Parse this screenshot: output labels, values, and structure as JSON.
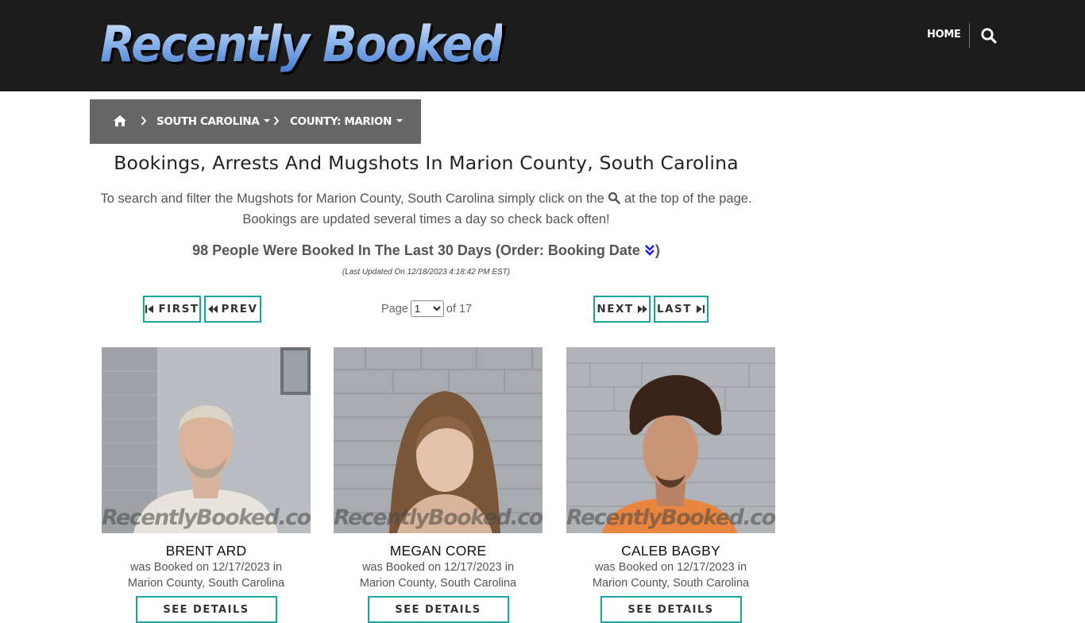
{
  "header": {
    "logo_text": "Recently Booked",
    "nav_home": "HOME",
    "search_icon": "search-icon"
  },
  "breadcrumb": {
    "home_icon": "home-icon",
    "items": [
      {
        "label": "SOUTH CAROLINA"
      },
      {
        "label": "COUNTY: MARION"
      }
    ]
  },
  "main": {
    "title": "Bookings, Arrests And Mugshots In Marion County, South Carolina",
    "intro_part1": "To search and filter the Mugshots for Marion County, South Carolina simply click on the",
    "intro_part2": "at the top of the page.",
    "intro_line2": "Bookings are updated several times a day so check back often!",
    "count_text": "98 People Were Booked In The Last 30 Days (Order: Booking Date",
    "count_close": ")",
    "updated": "(Last Updated On 12/18/2023 4:18:42 PM EST)"
  },
  "pagination": {
    "first": "FIRST",
    "prev": "PREV",
    "next": "NEXT",
    "last": "LAST",
    "page_label": "Page",
    "current_page": "1",
    "of_label": "of 17"
  },
  "watermark": "RecentlyBooked.com",
  "people": [
    {
      "name": "BRENT ARD",
      "line1": "was Booked on 12/17/2023 in",
      "line2": "Marion County, South Carolina",
      "button": "SEE DETAILS"
    },
    {
      "name": "MEGAN CORE",
      "line1": "was Booked on 12/17/2023 in",
      "line2": "Marion County, South Carolina",
      "button": "SEE DETAILS"
    },
    {
      "name": "CALEB BAGBY",
      "line1": "was Booked on 12/17/2023 in",
      "line2": "Marion County, South Carolina",
      "button": "SEE DETAILS"
    }
  ],
  "colors": {
    "header_bg": "#1c1c1c",
    "breadcrumb_bg": "#666666",
    "accent": "#17a69e",
    "order_icon": "#1a1ae0"
  }
}
